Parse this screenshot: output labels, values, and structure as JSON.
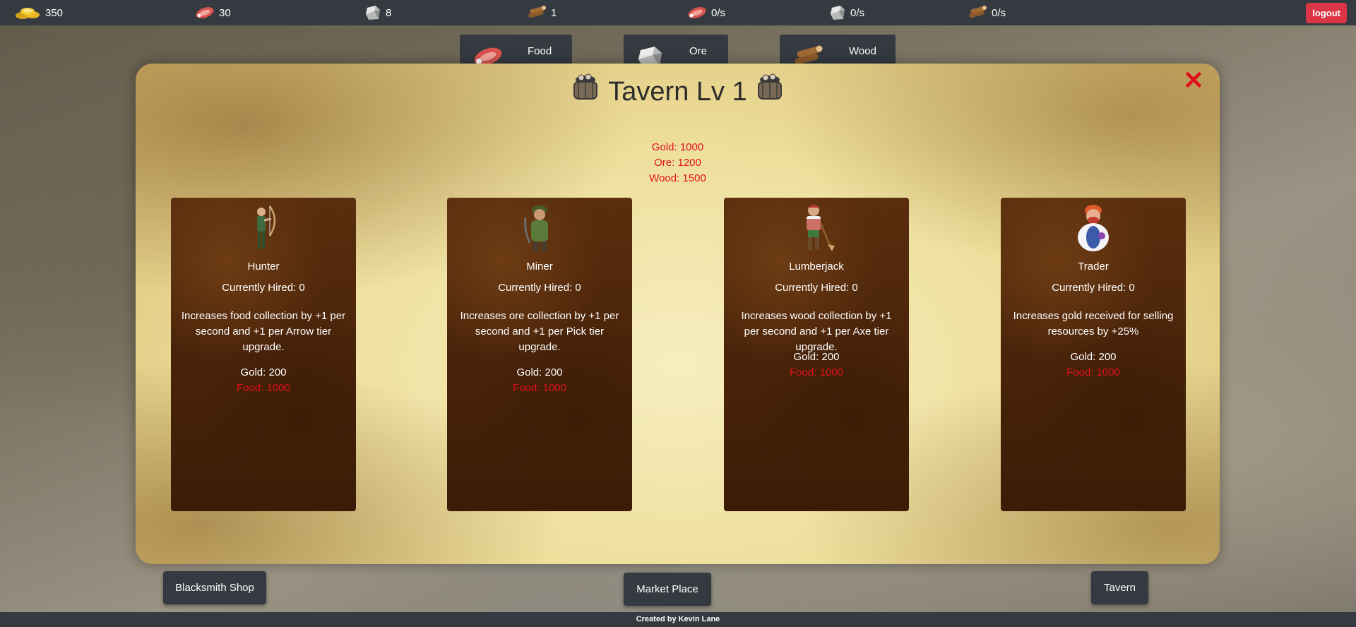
{
  "topbar": {
    "gold": "350",
    "food": "30",
    "ore": "8",
    "wood": "1",
    "food_rate": "0/s",
    "ore_rate": "0/s",
    "wood_rate": "0/s",
    "logout_label": "logout"
  },
  "resource_tabs": [
    {
      "label": "Food",
      "icon": "meat-icon"
    },
    {
      "label": "Ore",
      "icon": "ore-icon"
    },
    {
      "label": "Wood",
      "icon": "wood-icon"
    }
  ],
  "modal": {
    "title": "Tavern Lv 1",
    "close_symbol": "✕",
    "upgrade_cost": [
      "Gold: 1000",
      "Ore: 1200",
      "Wood: 1500"
    ],
    "cards": [
      {
        "name": "Hunter",
        "hired": "Currently Hired: 0",
        "description": "Increases food collection by +1 per second and +1 per Arrow tier upgrade.",
        "gold": "Gold: 200",
        "food": "Food: 1000"
      },
      {
        "name": "Miner",
        "hired": "Currently Hired: 0",
        "description": "Increases ore collection by +1 per second and +1 per Pick tier upgrade.",
        "gold": "Gold: 200",
        "food": "Food: 1000"
      },
      {
        "name": "Lumberjack",
        "hired": "Currently Hired: 0",
        "description": "Increases wood collection by +1 per second and +1 per Axe tier upgrade.",
        "gold": "Gold: 200",
        "food": "Food: 1000"
      },
      {
        "name": "Trader",
        "hired": "Currently Hired: 0",
        "description": "Increases gold received for selling resources by +25%",
        "gold": "Gold: 200",
        "food": "Food: 1000"
      }
    ]
  },
  "nav": {
    "blacksmith": "Blacksmith Shop",
    "market": "Market Place",
    "tavern": "Tavern"
  },
  "footer": "Created by Kevin Lane",
  "colors": {
    "bar": "#343a40",
    "cost_red": "#e0101b",
    "logout": "#dc3545"
  }
}
